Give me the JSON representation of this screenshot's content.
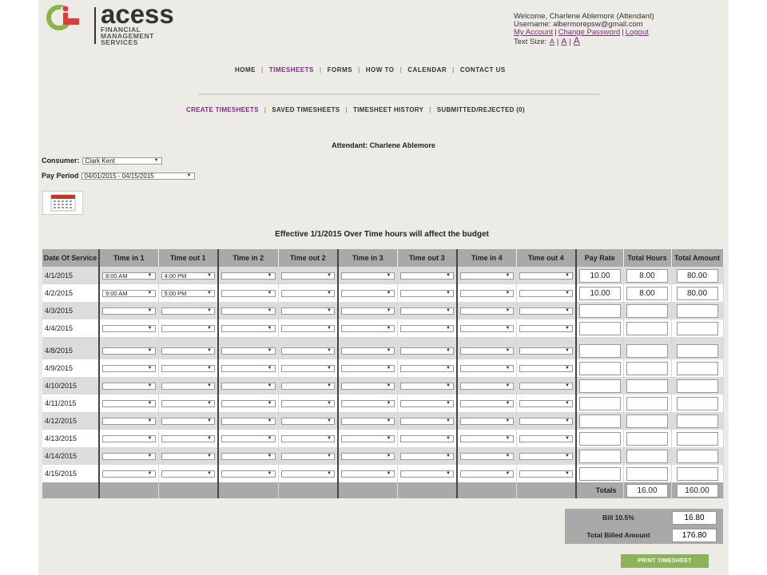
{
  "header": {
    "logo_text": "acess",
    "logo_sub": [
      "FINANCIAL",
      "MANAGEMENT",
      "SERVICES"
    ],
    "welcome": "Welcome, Charlene Ablemore (Attendant)",
    "username": "Username: albermorepsw@gmail.com",
    "links": {
      "my_account": "My Account",
      "change_password": "Change Password",
      "logout": "Logout"
    },
    "text_size_label": "Text Size:",
    "text_size_options": [
      "A",
      "A",
      "A"
    ]
  },
  "nav": {
    "main": [
      "HOME",
      "TIMESHEETS",
      "FORMS",
      "HOW TO",
      "CALENDAR",
      "CONTACT US"
    ],
    "active_main": "TIMESHEETS",
    "sub": [
      "CREATE TIMESHEETS",
      "SAVED TIMESHEETS",
      "TIMESHEET HISTORY",
      "SUBMITTED/REJECTED (0)"
    ],
    "active_sub": "CREATE TIMESHEETS"
  },
  "form": {
    "attendant": "Attendant: Charlene Ablemore",
    "consumer_label": "Consumer:",
    "consumer_value": "Clark Kent",
    "pay_period_label": "Pay Period",
    "pay_period_value": "04/01/2015 - 04/15/2015",
    "calendar_icon_text": "CALENDAR"
  },
  "notice": "Effective 1/1/2015 Over Time hours will affect the budget",
  "table": {
    "headers": [
      "Date Of Service",
      "Time in 1",
      "Time out 1",
      "Time in 2",
      "Time out 2",
      "Time in 3",
      "Time out 3",
      "Time in 4",
      "Time out 4",
      "Pay Rate",
      "Total Hours",
      "Total Amount"
    ],
    "rows": [
      {
        "date": "4/1/2015",
        "times": [
          "8:00 AM",
          "4:00 PM",
          "",
          "",
          "",
          "",
          "",
          ""
        ],
        "pay_rate": "10.00",
        "hours": "8.00",
        "amount": "80.00"
      },
      {
        "date": "4/2/2015",
        "times": [
          "9:00 AM",
          "5:00 PM",
          "",
          "",
          "",
          "",
          "",
          ""
        ],
        "pay_rate": "10.00",
        "hours": "8.00",
        "amount": "80.00"
      },
      {
        "date": "4/3/2015",
        "times": [
          "",
          "",
          "",
          "",
          "",
          "",
          "",
          ""
        ],
        "pay_rate": "",
        "hours": "",
        "amount": ""
      },
      {
        "date": "4/4/2015",
        "times": [
          "",
          "",
          "",
          "",
          "",
          "",
          "",
          ""
        ],
        "pay_rate": "",
        "hours": "",
        "amount": ""
      },
      {
        "date": "4/8/2015",
        "times": [
          "",
          "",
          "",
          "",
          "",
          "",
          "",
          ""
        ],
        "pay_rate": "",
        "hours": "",
        "amount": ""
      },
      {
        "date": "4/9/2015",
        "times": [
          "",
          "",
          "",
          "",
          "",
          "",
          "",
          ""
        ],
        "pay_rate": "",
        "hours": "",
        "amount": ""
      },
      {
        "date": "4/10/2015",
        "times": [
          "",
          "",
          "",
          "",
          "",
          "",
          "",
          ""
        ],
        "pay_rate": "",
        "hours": "",
        "amount": ""
      },
      {
        "date": "4/11/2015",
        "times": [
          "",
          "",
          "",
          "",
          "",
          "",
          "",
          ""
        ],
        "pay_rate": "",
        "hours": "",
        "amount": ""
      },
      {
        "date": "4/12/2015",
        "times": [
          "",
          "",
          "",
          "",
          "",
          "",
          "",
          ""
        ],
        "pay_rate": "",
        "hours": "",
        "amount": ""
      },
      {
        "date": "4/13/2015",
        "times": [
          "",
          "",
          "",
          "",
          "",
          "",
          "",
          ""
        ],
        "pay_rate": "",
        "hours": "",
        "amount": ""
      },
      {
        "date": "4/14/2015",
        "times": [
          "",
          "",
          "",
          "",
          "",
          "",
          "",
          ""
        ],
        "pay_rate": "",
        "hours": "",
        "amount": ""
      },
      {
        "date": "4/15/2015",
        "times": [
          "",
          "",
          "",
          "",
          "",
          "",
          "",
          ""
        ],
        "pay_rate": "",
        "hours": "",
        "amount": ""
      }
    ],
    "totals_label": "Totals",
    "total_hours": "16.00",
    "total_amount": "160.00"
  },
  "billing": {
    "bill_label": "Bill 10.5%",
    "bill_value": "16.80",
    "total_billed_label": "Total Billed Amount",
    "total_billed_value": "176.80"
  },
  "print_button": "PRINT TIMESHEET",
  "colors": {
    "accent_purple": "#7a2d7a",
    "accent_green": "#8db35a",
    "logo_red": "#e03a3e",
    "logo_green": "#8ab34a"
  }
}
